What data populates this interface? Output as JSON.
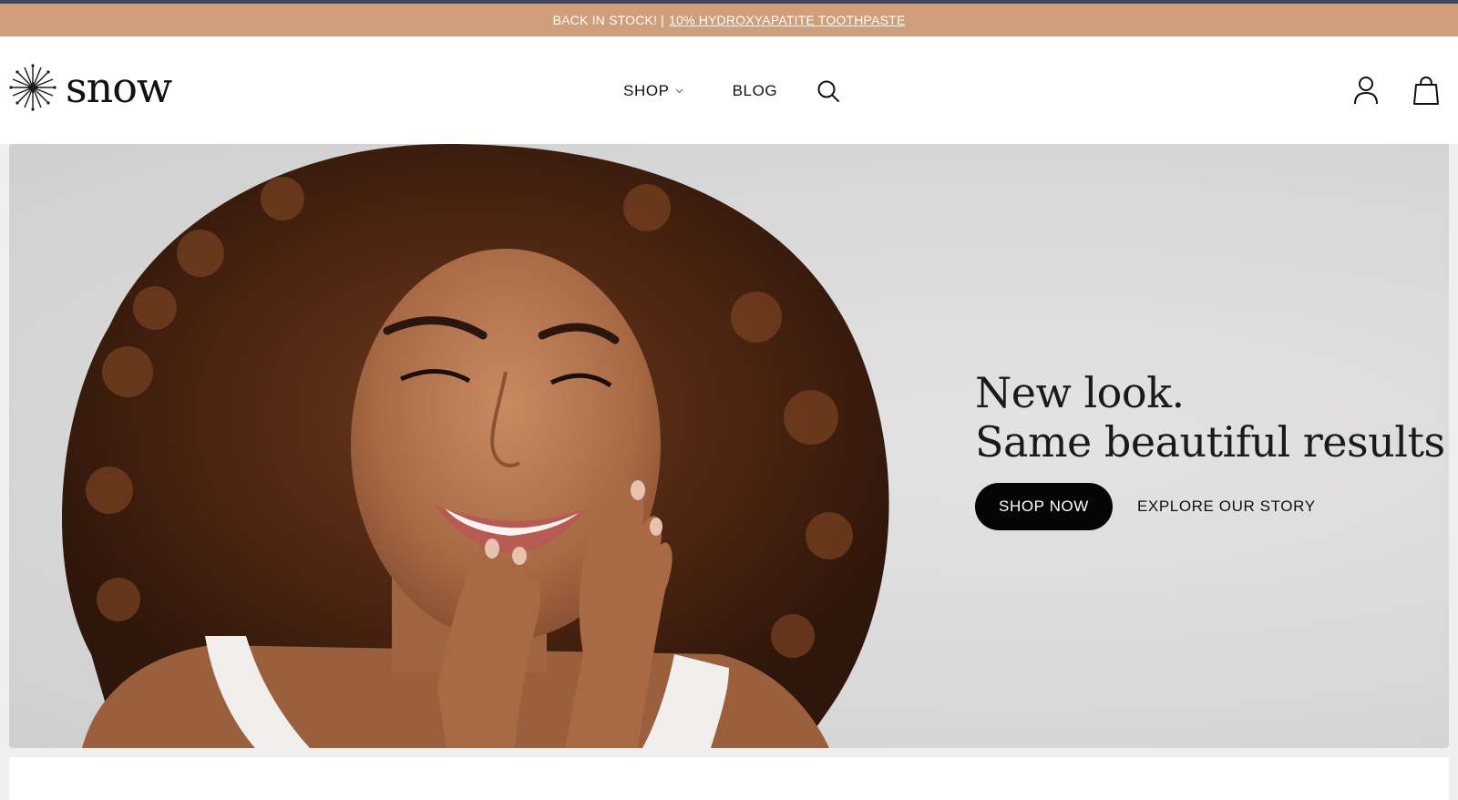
{
  "announcement": {
    "prefix": "BACK IN STOCK!",
    "separator": "|",
    "link_text": "10% HYDROXYAPATITE TOOTHPASTE"
  },
  "header": {
    "logo_text": "snow",
    "nav": [
      {
        "label": "SHOP",
        "has_dropdown": true,
        "icon": "chevron-down-icon"
      },
      {
        "label": "BLOG"
      }
    ],
    "icons": [
      "search-icon",
      "account-icon",
      "shopping-bag-icon"
    ]
  },
  "hero": {
    "headline_line1": "New look.",
    "headline_line2": "Same beautiful results",
    "primary_cta": "SHOP NOW",
    "secondary_cta": "EXPLORE OUR STORY"
  },
  "colors": {
    "announcement_bg": "#cf9f7c",
    "top_strip": "#414a59",
    "cta_bg": "#050505",
    "hero_bg": "#dcdbdb"
  }
}
